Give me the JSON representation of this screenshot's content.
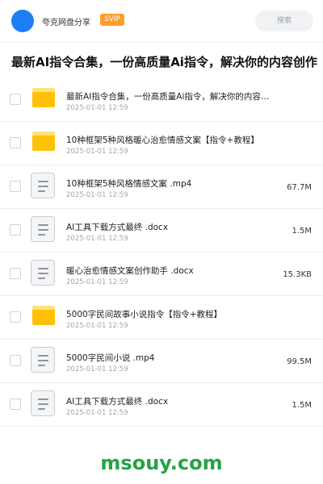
{
  "header": {
    "app_name": "夸克网盘分享",
    "badge": "SVIP",
    "search_label": "搜索"
  },
  "title": "最新AI指令合集，一份高质量Ai指令，解决你的内容创作【",
  "files": [
    {
      "type": "folder",
      "name": "最新AI指令合集，一份高质量Ai指令，解决你的内容…",
      "date": "2025-01-01 12:59",
      "size": ""
    },
    {
      "type": "folder",
      "name": "10种框架5种风格暖心治愈情感文案【指令+教程】",
      "date": "2025-01-01 12:59",
      "size": ""
    },
    {
      "type": "file",
      "name": "10种框架5种风格情感文案 .mp4",
      "date": "2025-01-01 12:59",
      "size": "67.7M"
    },
    {
      "type": "file",
      "name": "AI工具下载方式最终 .docx",
      "date": "2025-01-01 12:59",
      "size": "1.5M"
    },
    {
      "type": "file",
      "name": "暖心治愈情感文案创作助手 .docx",
      "date": "2025-01-01 12:59",
      "size": "15.3KB"
    },
    {
      "type": "folder",
      "name": "5000字民间故事小说指令【指令+教程】",
      "date": "2025-01-01 12:59",
      "size": ""
    },
    {
      "type": "file",
      "name": "5000字民间小说 .mp4",
      "date": "2025-01-01 12:59",
      "size": "99.5M"
    },
    {
      "type": "file",
      "name": "AI工具下载方式最终 .docx",
      "date": "2025-01-01 12:59",
      "size": "1.5M"
    }
  ],
  "watermark": "msouy.com",
  "colors": {
    "accent": "#1e7df5",
    "badge": "#ff9c2a",
    "folder": "#ffc107",
    "watermark": "#25a244"
  }
}
